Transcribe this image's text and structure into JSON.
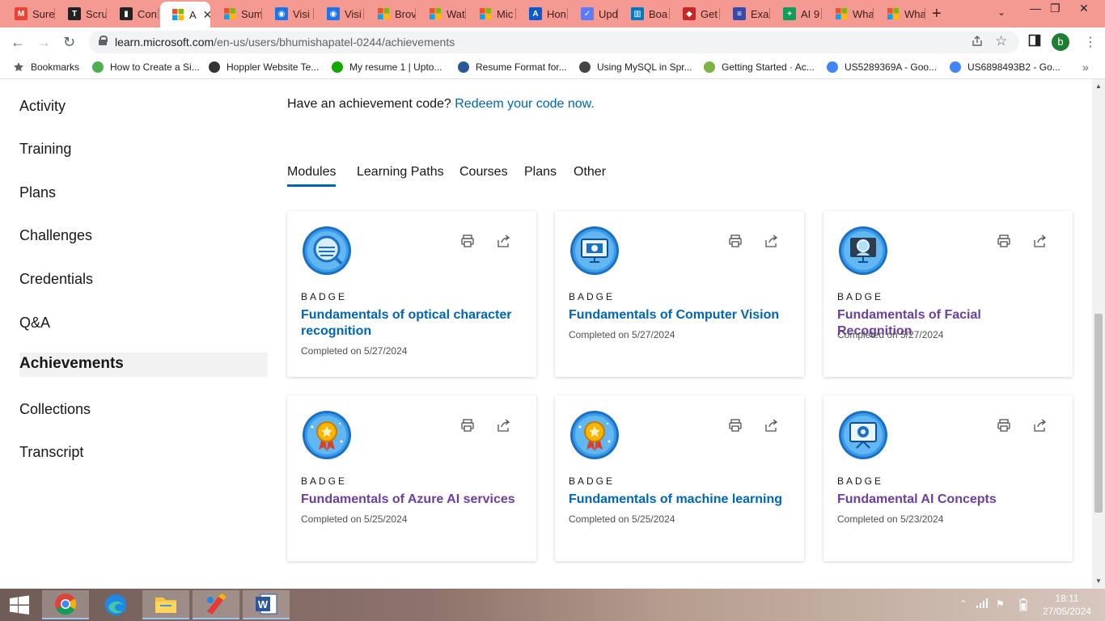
{
  "browser": {
    "tabs": [
      {
        "title": "Sure",
        "favicon_color": "#ea4335",
        "favicon_glyph": "M"
      },
      {
        "title": "Scru",
        "favicon_color": "#222222",
        "favicon_glyph": "T"
      },
      {
        "title": "Con",
        "favicon_color": "#222222",
        "favicon_glyph": "▮"
      },
      {
        "title": "A",
        "favicon_color": "#f25022",
        "favicon_glyph": "",
        "active": true
      },
      {
        "title": "Sum",
        "favicon_color": "#f25022",
        "favicon_glyph": ""
      },
      {
        "title": "Visi",
        "favicon_color": "#1a73e8",
        "favicon_glyph": "◉"
      },
      {
        "title": "Visi",
        "favicon_color": "#1a73e8",
        "favicon_glyph": "◉"
      },
      {
        "title": "Brov",
        "favicon_color": "#f25022",
        "favicon_glyph": ""
      },
      {
        "title": "Wat",
        "favicon_color": "#f25022",
        "favicon_glyph": ""
      },
      {
        "title": "Mic",
        "favicon_color": "#f25022",
        "favicon_glyph": ""
      },
      {
        "title": "Hon",
        "favicon_color": "#0a58ca",
        "favicon_glyph": "A"
      },
      {
        "title": "Upd",
        "favicon_color": "#5b7cfa",
        "favicon_glyph": "✓"
      },
      {
        "title": "Boa",
        "favicon_color": "#0079bf",
        "favicon_glyph": "▥"
      },
      {
        "title": "Get",
        "favicon_color": "#c62828",
        "favicon_glyph": "◆"
      },
      {
        "title": "Exar",
        "favicon_color": "#3949ab",
        "favicon_glyph": "≡"
      },
      {
        "title": "AI 9",
        "favicon_color": "#0f9d58",
        "favicon_glyph": "+"
      },
      {
        "title": "Wha",
        "favicon_color": "#f25022",
        "favicon_glyph": ""
      },
      {
        "title": "Wha",
        "favicon_color": "#f25022",
        "favicon_glyph": ""
      }
    ],
    "new_tab": "+",
    "tab_menu": "⌄",
    "window": {
      "minimize": "—",
      "restore": "❐",
      "close": "✕"
    },
    "url_host": "learn.microsoft.com",
    "url_path": "/en-us/users/bhumishapatel-0244/achievements",
    "profile_initial": "b",
    "bookmarks": [
      {
        "label": "Bookmarks",
        "icon": "star-icon",
        "color": "#5f6368"
      },
      {
        "label": "How to Create a Si...",
        "icon": "leaf-icon",
        "color": "#4caf50"
      },
      {
        "label": "Hoppler Website Te...",
        "icon": "ost-icon",
        "color": "#333333"
      },
      {
        "label": "My resume 1 | Upto...",
        "icon": "upwork-icon",
        "color": "#14a800"
      },
      {
        "label": "Resume Format for...",
        "icon": "shine-icon",
        "color": "#2b5797"
      },
      {
        "label": "Using MySQL in Spr...",
        "icon": "globe-icon",
        "color": "#444444"
      },
      {
        "label": "Getting Started · Ac...",
        "icon": "check-icon",
        "color": "#7cb342"
      },
      {
        "label": "US5289369A - Goo...",
        "icon": "google-icon",
        "color": "#4285f4"
      },
      {
        "label": "US6898493B2 - Go...",
        "icon": "google-icon",
        "color": "#4285f4"
      }
    ]
  },
  "sidenav": {
    "items": [
      {
        "label": "Activity"
      },
      {
        "label": "Training"
      },
      {
        "label": "Plans"
      },
      {
        "label": "Challenges"
      },
      {
        "label": "Credentials"
      },
      {
        "label": "Q&A"
      },
      {
        "label": "Achievements",
        "active": true
      },
      {
        "label": "Collections"
      },
      {
        "label": "Transcript"
      }
    ]
  },
  "main": {
    "redeem_text": "Have an achievement code? ",
    "redeem_link": "Redeem your code now.",
    "tabs": [
      {
        "label": "Modules",
        "active": true
      },
      {
        "label": "Learning Paths"
      },
      {
        "label": "Courses"
      },
      {
        "label": "Plans"
      },
      {
        "label": "Other"
      }
    ],
    "cards": [
      {
        "type": "BADGE",
        "title": "Fundamentals of optical character recognition",
        "date": "Completed on 5/27/2024",
        "visited": false,
        "icon": "magnifier-badge-icon"
      },
      {
        "type": "BADGE",
        "title": "Fundamentals of Computer Vision",
        "date": "Completed on 5/27/2024",
        "visited": false,
        "icon": "monitor-badge-icon"
      },
      {
        "type": "BADGE",
        "title": "Fundamentals of Facial Recognition",
        "date": "Completed on 5/27/2024",
        "visited": true,
        "icon": "face-badge-icon"
      },
      {
        "type": "BADGE",
        "title": "Fundamentals of Azure AI services",
        "date": "Completed on 5/25/2024",
        "visited": true,
        "icon": "medal-badge-icon"
      },
      {
        "type": "BADGE",
        "title": "Fundamentals of machine learning",
        "date": "Completed on 5/25/2024",
        "visited": false,
        "icon": "medal-badge-icon"
      },
      {
        "type": "BADGE",
        "title": "Fundamental AI Concepts",
        "date": "Completed on 5/23/2024",
        "visited": true,
        "icon": "ai-monitor-badge-icon"
      }
    ]
  },
  "taskbar": {
    "apps": [
      "chrome-icon",
      "edge-icon",
      "file-explorer-icon",
      "paint-icon",
      "word-icon"
    ],
    "time": "18:11",
    "date": "27/05/2024"
  },
  "colors": {
    "tab_strip": "#f59a93",
    "link": "#0065b3",
    "visited": "#6b3fa0"
  }
}
